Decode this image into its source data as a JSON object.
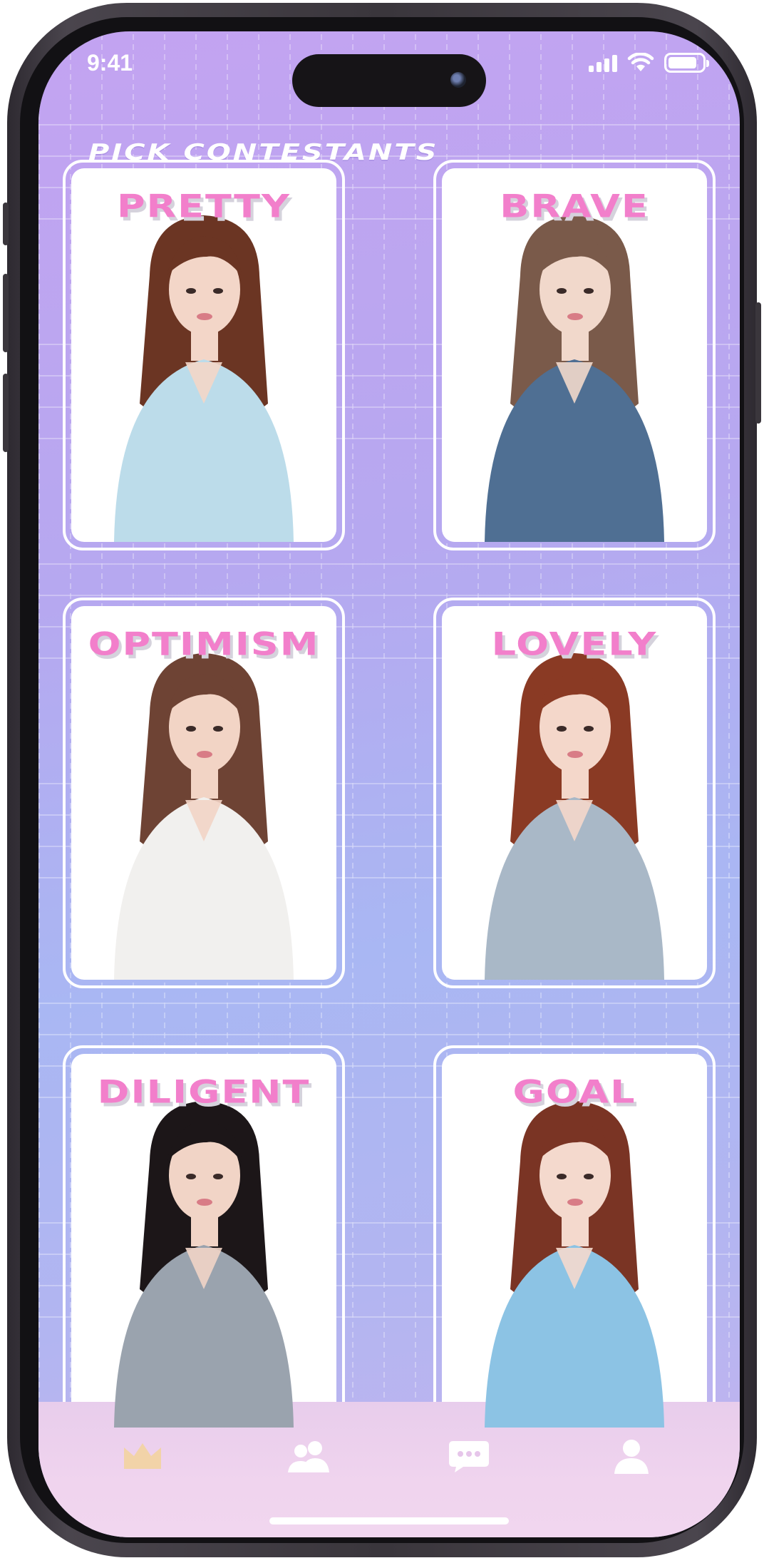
{
  "status_bar": {
    "time": "9:41",
    "battery_level": 0.85,
    "signal_bars": 4
  },
  "header": {
    "title": "PICK CONTESTANTS"
  },
  "contestants": [
    {
      "label": "PRETTY",
      "hair": "#6b3523",
      "top": "#bcdcea",
      "skin": "#f3d6c8"
    },
    {
      "label": "BRAVE",
      "hair": "#7a5a4a",
      "top": "#4f6f93",
      "skin": "#f1d8cb"
    },
    {
      "label": "OPTIMISM",
      "hair": "#6e4334",
      "top": "#f1f0ee",
      "skin": "#f2d4c5"
    },
    {
      "label": "LOVELY",
      "hair": "#8a3a24",
      "top": "#a9b8c7",
      "skin": "#f4d7ca"
    },
    {
      "label": "DILIGENT",
      "hair": "#1c1618",
      "top": "#9aa3ae",
      "skin": "#f1d4c6"
    },
    {
      "label": "GOAL",
      "hair": "#7a3424",
      "top": "#8cc3e4",
      "skin": "#f4d9cd"
    }
  ],
  "tabs": [
    {
      "icon": "crown-icon",
      "color": "#f2d3a8",
      "active": true
    },
    {
      "icon": "users-icon",
      "color": "#ffffff",
      "active": false
    },
    {
      "icon": "chat-icon",
      "color": "#ffffff",
      "active": false
    },
    {
      "icon": "person-icon",
      "color": "#ffffff",
      "active": false
    }
  ],
  "colors": {
    "accent_pink": "#f27fcb",
    "background_start": "#c3a3f1",
    "background_end": "#a9b7f3"
  }
}
